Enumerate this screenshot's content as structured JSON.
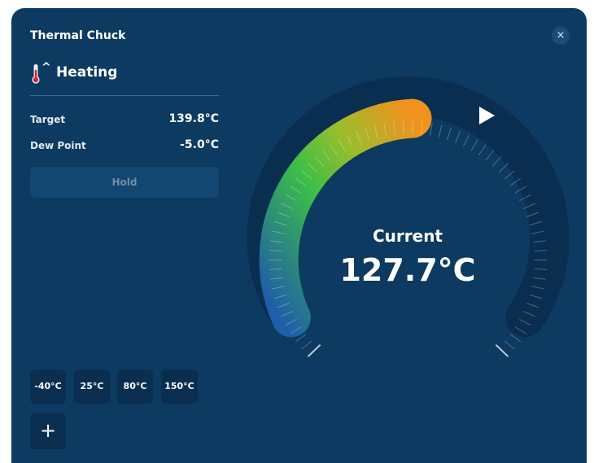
{
  "window": {
    "title": "Thermal Chuck",
    "close_glyph": "×"
  },
  "mode": {
    "label": "Heating",
    "icon": "thermometer-icon",
    "indicator": "^"
  },
  "readings": [
    {
      "label": "Target",
      "value": "139.8°C"
    },
    {
      "label": "Dew Point",
      "value": "-5.0°C"
    }
  ],
  "hold_button": {
    "label": "Hold"
  },
  "presets": [
    "-40°C",
    "25°C",
    "80°C",
    "150°C"
  ],
  "add_button": {
    "label": "+"
  },
  "gauge": {
    "label": "Current",
    "value": "127.7°C",
    "play_icon": "play-icon",
    "colors": {
      "track": "#092e50",
      "gradient_start": "#1f5ea8",
      "gradient_mid": "#3cbf46",
      "gradient_end": "#f0921e"
    }
  }
}
